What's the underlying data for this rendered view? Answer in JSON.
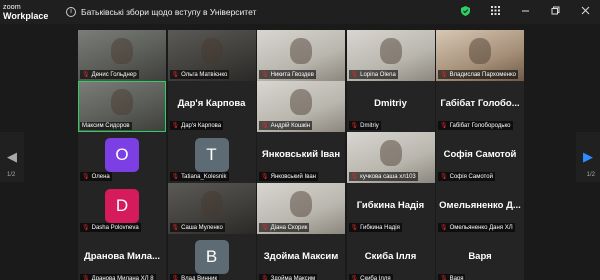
{
  "app": {
    "logo_line1": "zoom",
    "logo_line2": "Workplace",
    "info_icon": "i"
  },
  "meeting_title": "Батьківські збори щодо вступу в Університет",
  "titlebar_icons": {
    "shield": "shield-icon",
    "grid": "grid-icon",
    "minimize": "minimize-icon",
    "restore": "restore-icon",
    "close": "close-icon"
  },
  "pager": {
    "left_arrow": "◀",
    "right_arrow": "▶",
    "left_page": "1/2",
    "right_page": "1/2"
  },
  "colors": {
    "accent_blue": "#2d8cff",
    "active_green": "#2fce62",
    "muted_red": "#e02828"
  },
  "tiles": [
    {
      "name": "Денис Гольднер",
      "kind": "video",
      "muted": true
    },
    {
      "name": "Ольга Матвієнко",
      "kind": "video",
      "muted": true
    },
    {
      "name": "Никита Гвоздев",
      "kind": "video",
      "muted": true
    },
    {
      "name": "Lopina Olena",
      "kind": "video",
      "muted": true
    },
    {
      "name": "Владислав Пархоменко",
      "kind": "video",
      "muted": true
    },
    {
      "name": "Максим Сидоров",
      "kind": "video",
      "muted": false,
      "active": true
    },
    {
      "name": "Дар'я Карпова",
      "big": "Дар'я Карпова",
      "kind": "text",
      "muted": true
    },
    {
      "name": "Андрій Кошкін",
      "kind": "video",
      "muted": true
    },
    {
      "name": "Dmitriy",
      "big": "Dmitriy",
      "kind": "text",
      "muted": true
    },
    {
      "name": "Габібат Голобородько",
      "big": "Габібат Голобо...",
      "kind": "text",
      "muted": true
    },
    {
      "name": "Олена",
      "kind": "avatar",
      "letter": "O",
      "color": "#7b3fe4",
      "muted": true
    },
    {
      "name": "Tatiana_Kolesnik",
      "kind": "avatar",
      "letter": "T",
      "color": "#5d6b75",
      "muted": true
    },
    {
      "name": "Янковський Іван",
      "big": "Янковський Іван",
      "kind": "text",
      "muted": true
    },
    {
      "name": "кучкова саша хл103",
      "kind": "video",
      "muted": true
    },
    {
      "name": "Софія Самотой",
      "big": "Софія Самотой",
      "kind": "text",
      "muted": true
    },
    {
      "name": "Dasha Polovneva",
      "kind": "avatar",
      "letter": "D",
      "color": "#d61b5c",
      "muted": true
    },
    {
      "name": "Саша Муленко",
      "kind": "video",
      "muted": true
    },
    {
      "name": "Діана Скорик",
      "kind": "video",
      "muted": true
    },
    {
      "name": "Гибкина Надія",
      "big": "Гибкина Надія",
      "kind": "text",
      "muted": true
    },
    {
      "name": "Омельяненко Даня ХЛ",
      "big": "Омельяненко Д...",
      "kind": "text",
      "muted": true
    },
    {
      "name": "Дранова Милана ХЛ 8",
      "big": "Дранова Мила...",
      "kind": "text",
      "muted": true
    },
    {
      "name": "Влад Винник",
      "kind": "avatar",
      "letter": "B",
      "color": "#5d6b75",
      "muted": true
    },
    {
      "name": "Здойма Максим",
      "big": "Здойма Максим",
      "kind": "text",
      "muted": true
    },
    {
      "name": "Скиба Ілля",
      "big": "Скиба Ілля",
      "kind": "text",
      "muted": true
    },
    {
      "name": "Варя",
      "big": "Варя",
      "kind": "text",
      "muted": true
    }
  ]
}
